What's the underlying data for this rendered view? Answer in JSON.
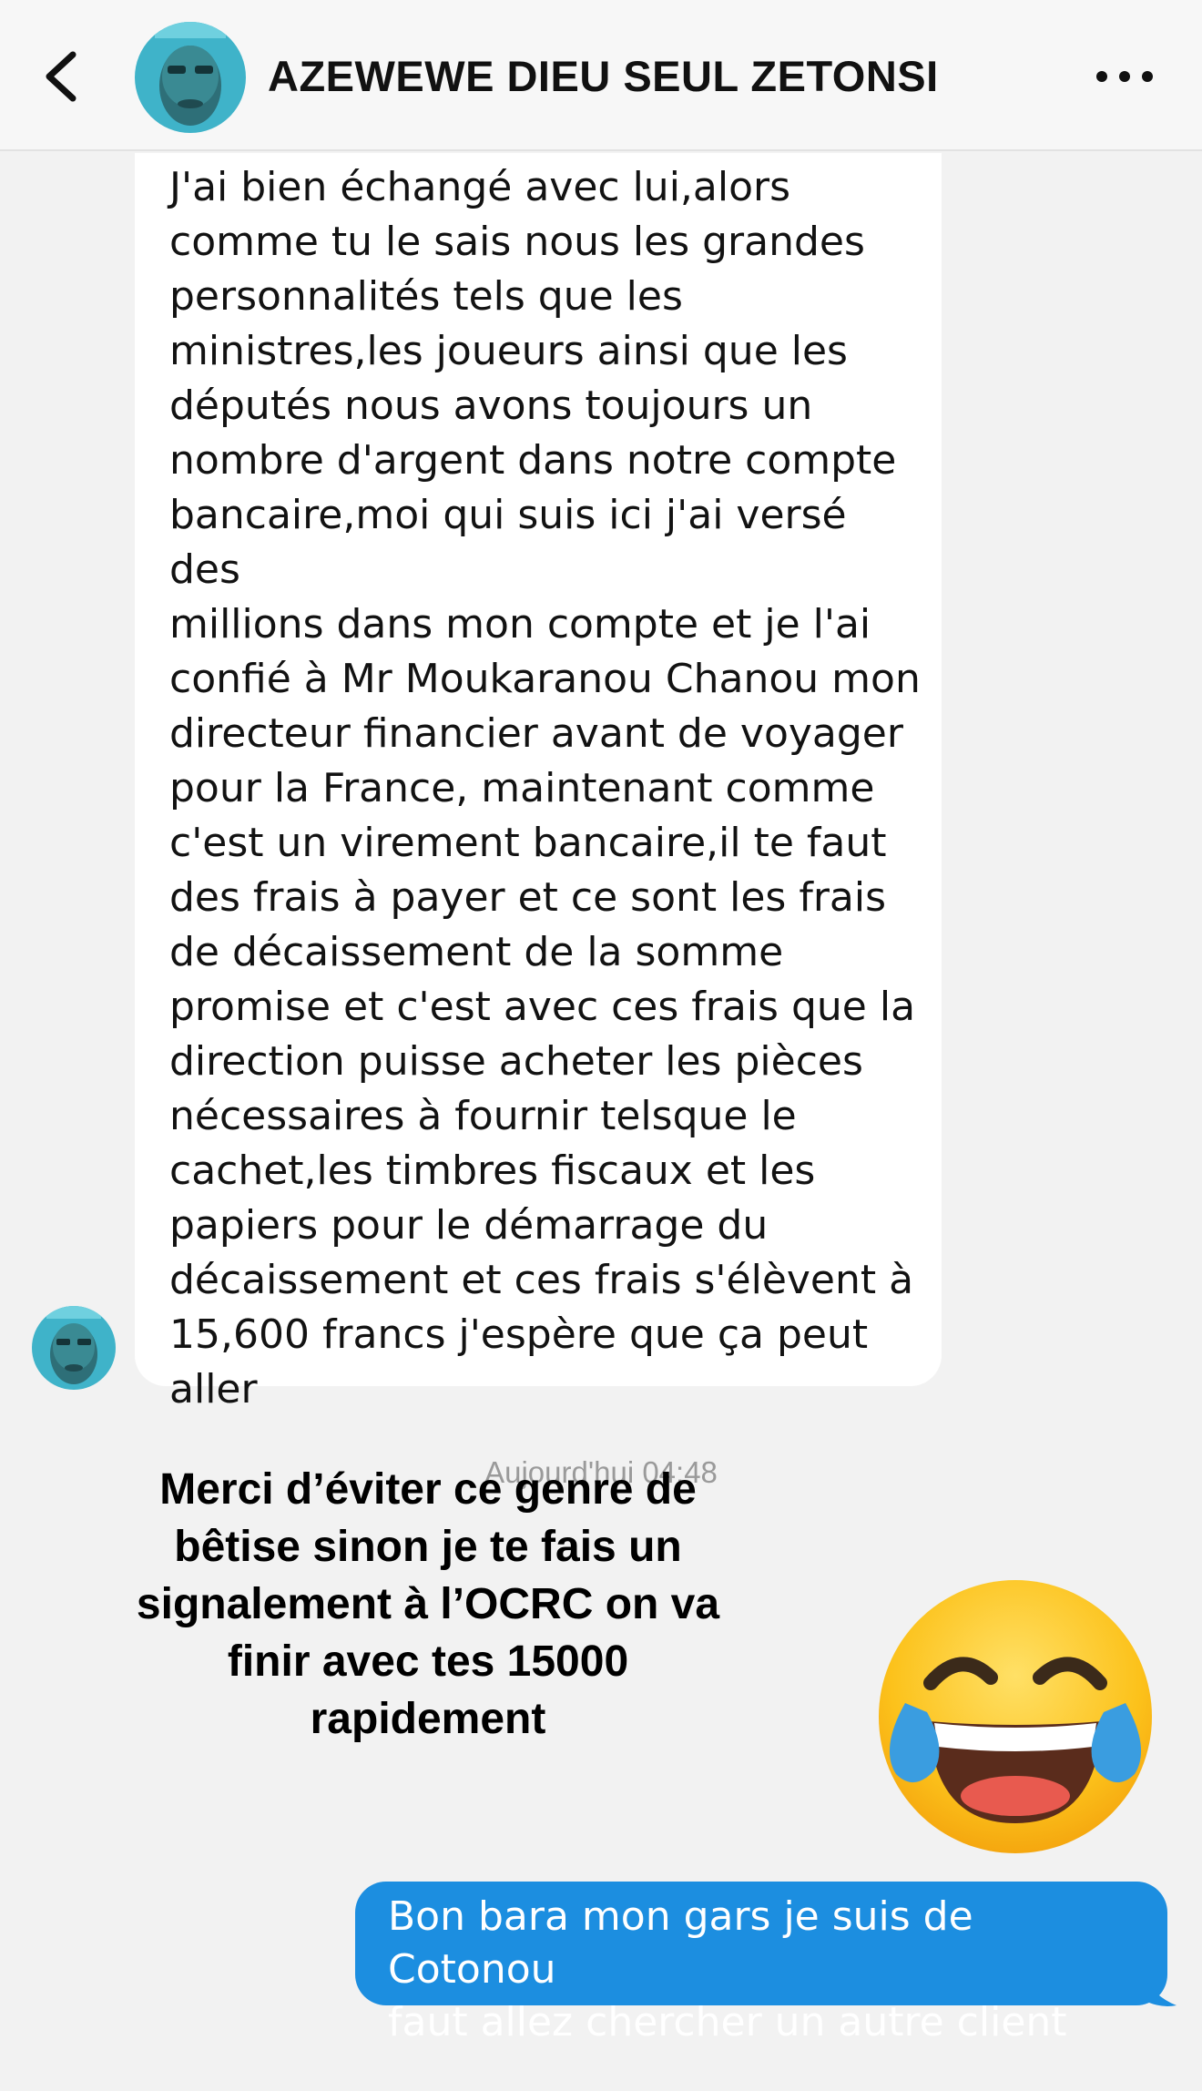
{
  "header": {
    "contact_name": "AZEWEWE DIEU SEUL ZETONSI",
    "back_icon": "chevron-left-icon",
    "more_icon": "ellipsis-icon"
  },
  "messages": {
    "received_text": "J'ai bien échangé avec lui,alors\ncomme tu le sais nous les grandes\npersonnalités tels que les\nministres,les joueurs ainsi que les\ndéputés nous avons toujours un\nnombre d'argent dans notre compte\nbancaire,moi qui suis ici j'ai versé des\nmillions dans mon compte et je l'ai\nconfié à Mr Moukaranou Chanou mon\ndirecteur financier avant de voyager\npour la France, maintenant comme\nc'est un virement bancaire,il te faut\ndes frais à payer et ce sont les frais\nde décaissement de la somme\npromise et c'est avec ces frais que la\ndirection puisse acheter les pièces\nnécessaires à fournir telsque le\ncachet,les timbres fiscaux et les\npapiers pour le démarrage du\ndécaissement et ces frais s'élèvent à\n15,600 francs j'espère que ça peut\naller",
    "timestamp": "Aujourd'hui 04:48",
    "sent_text": "Bon bara mon gars je suis de Cotonou\nfaut allez chercher un autre client"
  },
  "overlay": {
    "caption_lines": [
      "Merci d’éviter ce genre de",
      "bêtise sinon je te fais un",
      "signalement à l’OCRC on va",
      "finir avec tes 15000",
      "rapidement"
    ],
    "emoji": "face-with-tears-of-joy-icon"
  },
  "colors": {
    "background": "#f2f2f2",
    "received_bubble": "#ffffff",
    "sent_bubble": "#1c8ee0",
    "avatar_bg": "#3fb3c9"
  }
}
